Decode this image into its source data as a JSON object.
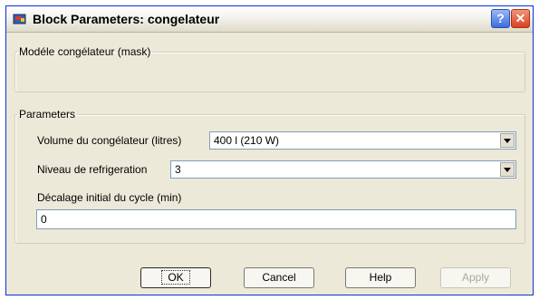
{
  "window": {
    "title": "Block Parameters: congelateur",
    "help_glyph": "?",
    "close_glyph": "✕"
  },
  "mask_section": {
    "legend": "Modéle congélateur (mask)"
  },
  "parameters": {
    "legend": "Parameters",
    "volume": {
      "label": "Volume du congélateur (litres)",
      "value": "400 l (210 W)"
    },
    "niveau": {
      "label": "Niveau de refrigeration",
      "value": "3"
    },
    "decalage": {
      "label": "Décalage initial du cycle (min)",
      "value": "0"
    }
  },
  "buttons": {
    "ok": "OK",
    "cancel": "Cancel",
    "help": "Help",
    "apply": "Apply"
  },
  "icons": {
    "app": "simulink-block-icon",
    "dropdown": "chevron-down-icon"
  }
}
